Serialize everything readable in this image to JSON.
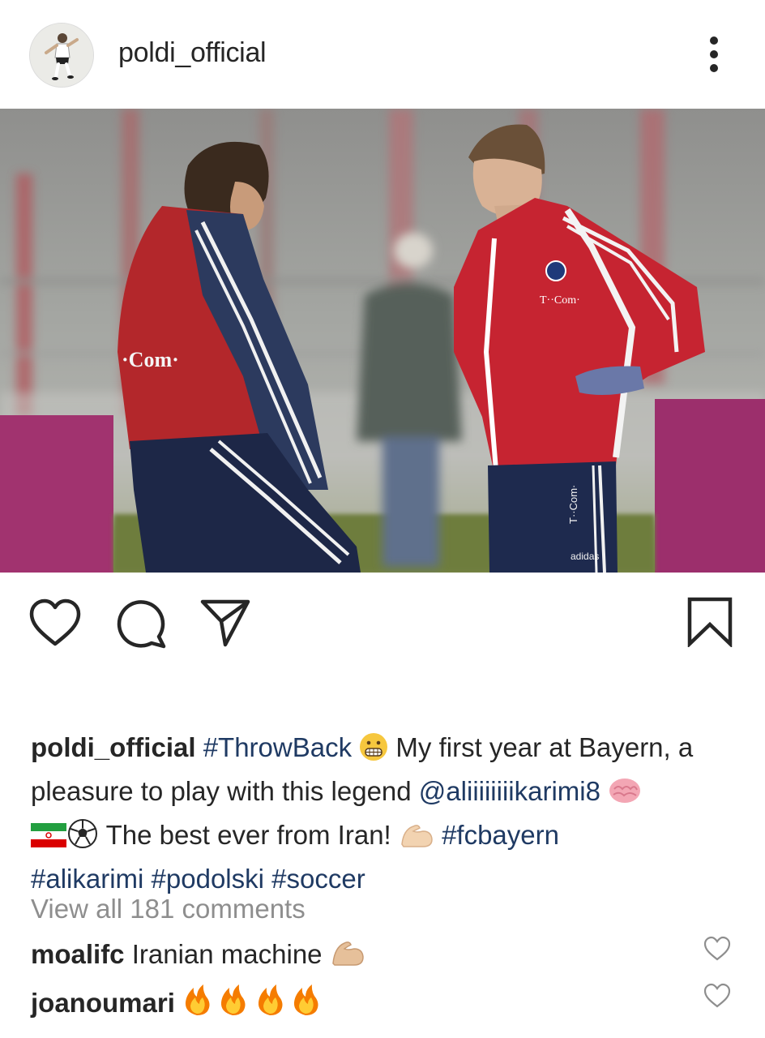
{
  "post": {
    "username": "poldi_official",
    "caption": {
      "username": "poldi_official",
      "tag_throwback": "#ThrowBack",
      "text1": " My first year at Bayern, a pleasure to play with this legend ",
      "mention": "@aliiiiiiiikarimi8",
      "text2": " The best ever from Iran! ",
      "tag_fcbayern": "#fcbayern",
      "tag_alikarimi": "#alikarimi",
      "tag_podolski": "#podolski",
      "tag_soccer": "#soccer"
    },
    "view_all_comments": "View all 181 comments",
    "comments": [
      {
        "username": "moalifc",
        "text": "Iranian machine"
      },
      {
        "username": "joanoumari",
        "text": ""
      }
    ],
    "photo_text": {
      "sponsor_front": "T··Com·",
      "sponsor_sleeve": "·Com·",
      "sponsor_shorts": "T··Com·",
      "shorts_brand": "adidas"
    }
  },
  "colors": {
    "hashtag": "#1f3a63",
    "muted": "#8e8e8e",
    "text": "#262626"
  },
  "icons": [
    "more-options-icon",
    "heart-icon",
    "comment-icon",
    "share-icon",
    "bookmark-icon"
  ]
}
